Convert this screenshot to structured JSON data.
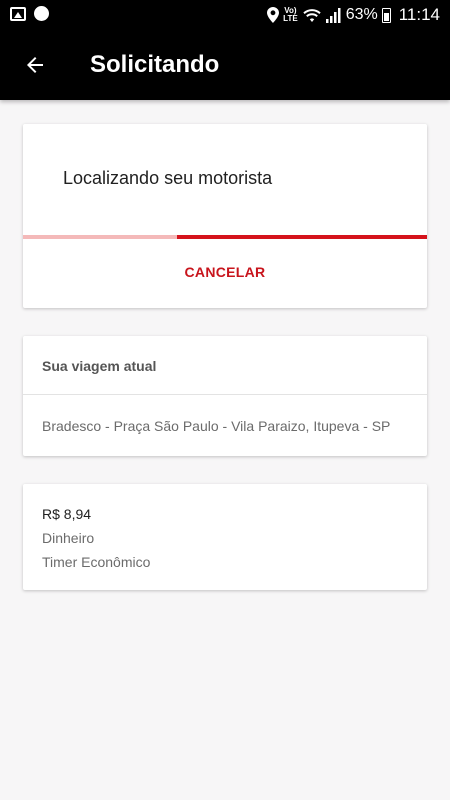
{
  "status_bar": {
    "battery_percent": "63%",
    "time": "11:14",
    "network": "VoLTE",
    "icons": [
      "image-icon",
      "circle-notification-icon",
      "location-icon",
      "volte-icon",
      "wifi-icon",
      "signal-icon",
      "battery-icon"
    ]
  },
  "app_bar": {
    "title": "Solicitando",
    "back_icon": "arrow-left-icon"
  },
  "request_card": {
    "message": "Localizando seu motorista",
    "progress": 0.62,
    "cancel_label": "CANCELAR"
  },
  "trip_card": {
    "header": "Sua viagem atual",
    "address": "Bradesco - Praça São Paulo - Vila Paraizo, Itupeva - SP"
  },
  "fare_card": {
    "price": "R$ 8,94",
    "payment_method": "Dinheiro",
    "category": "Timer Econômico"
  },
  "colors": {
    "accent": "#d5121b",
    "progress_track": "#f4b9b9",
    "app_bar": "#000000",
    "background": "#f7f6f7"
  }
}
